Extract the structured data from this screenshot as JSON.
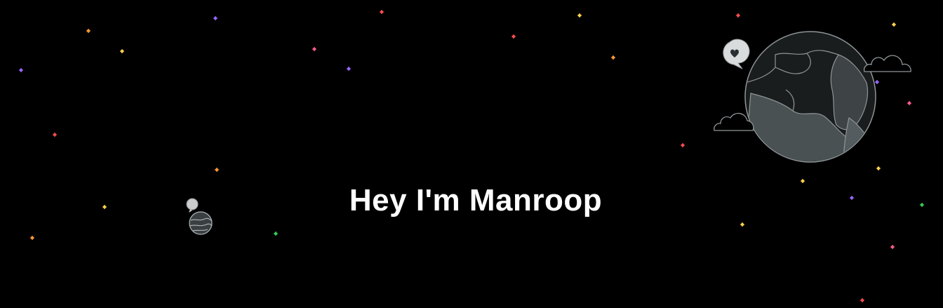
{
  "hero": {
    "headline": "Hey I'm Manroop"
  },
  "theme": {
    "background": "#000000",
    "text_color": "#ffffff",
    "planet_fill": "#3d4244",
    "planet_stroke": "#9aa0a3",
    "star_colors": [
      "#ff4d4d",
      "#ff9933",
      "#ffd24d",
      "#9966ff",
      "#33cc55",
      "#ff5c8a"
    ]
  },
  "decorations": {
    "big_planet_icon": "globe-with-heart-bubble-icon",
    "small_planet_icon": "small-planet-with-bubble-icon",
    "star_icon": "sparkle-star-icon"
  }
}
